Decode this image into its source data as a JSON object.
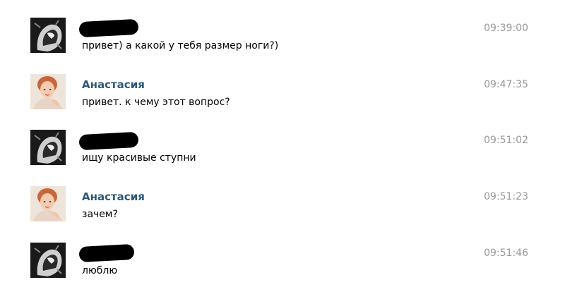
{
  "messages": [
    {
      "author": "",
      "author_redacted": true,
      "avatar": "dark-portrait-avatar",
      "text": "привет) а какой у тебя размер ноги?)",
      "time": "09:39:00"
    },
    {
      "author": "Анастасия",
      "author_redacted": false,
      "avatar": "girl-portrait-avatar",
      "text": "привет. к чему этот вопрос?",
      "time": "09:47:35"
    },
    {
      "author": "",
      "author_redacted": true,
      "avatar": "dark-portrait-avatar",
      "text": "ищу красивые ступни",
      "time": "09:51:02"
    },
    {
      "author": "Анастасия",
      "author_redacted": false,
      "avatar": "girl-portrait-avatar",
      "text": "зачем?",
      "time": "09:51:23"
    },
    {
      "author": "",
      "author_redacted": true,
      "avatar": "dark-portrait-avatar",
      "text": "люблю",
      "time": "09:51:46"
    }
  ],
  "colors": {
    "author": "#2b587a",
    "time": "#999999",
    "text": "#000000",
    "redaction": "#000000"
  }
}
